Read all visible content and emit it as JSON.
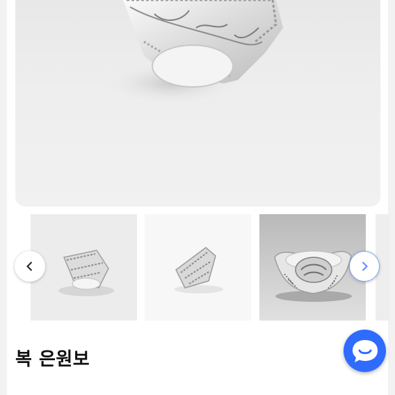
{
  "product": {
    "title": "복 은원보"
  },
  "gallery": {
    "main_image": "silver-ingot-photo",
    "thumbnails": [
      {
        "image": "silver-ingot-photo-1"
      },
      {
        "image": "silver-ingot-photo-2"
      },
      {
        "image": "silver-ingot-photo-3"
      },
      {
        "image": "silver-ingot-photo-4"
      }
    ],
    "prev_icon": "chevron-left-icon",
    "next_icon": "chevron-right-icon"
  },
  "chat": {
    "icon": "chat-bubble-icon",
    "color": "#2f6bff"
  },
  "colors": {
    "accent": "#2f6bff",
    "next_border": "#7ea6ff"
  }
}
